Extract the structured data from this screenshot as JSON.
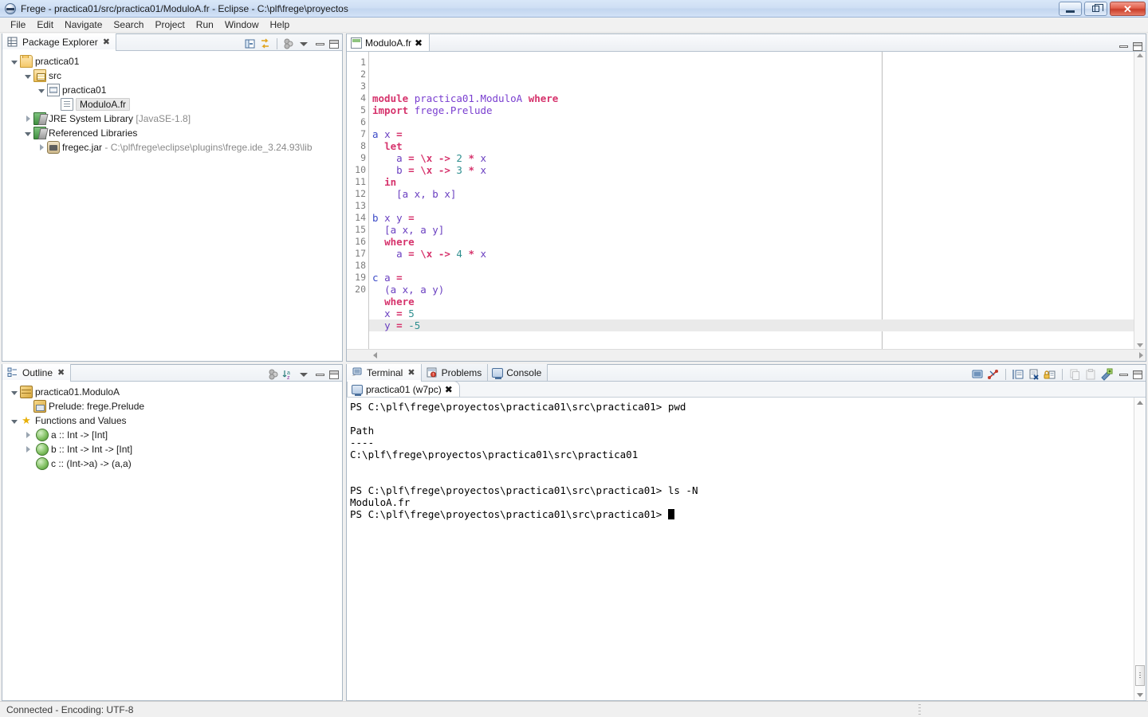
{
  "window": {
    "title": "Frege - practica01/src/practica01/ModuloA.fr - Eclipse - C:\\plf\\frege\\proyectos",
    "app_icon": "eclipse-icon",
    "controls": {
      "minimize": "minimize",
      "maximize": "restore",
      "close": "close"
    }
  },
  "menubar": {
    "items": [
      "File",
      "Edit",
      "Navigate",
      "Search",
      "Project",
      "Run",
      "Window",
      "Help"
    ]
  },
  "package_explorer": {
    "tab_label": "Package Explorer",
    "close_glyph": "✖",
    "toolbar": [
      "collapse-all-icon",
      "link-with-editor-icon",
      "view-menu-icon",
      "minimize-icon",
      "maximize-icon"
    ],
    "tree": [
      {
        "label": "practica01",
        "suffix": "",
        "icon": "project-folder-icon",
        "indent": 0,
        "twisty": "open",
        "selected": false
      },
      {
        "label": "src",
        "suffix": "",
        "icon": "source-folder-icon",
        "indent": 1,
        "twisty": "open",
        "selected": false
      },
      {
        "label": "practica01",
        "suffix": "",
        "icon": "package-icon",
        "indent": 2,
        "twisty": "open",
        "selected": false
      },
      {
        "label": "ModuloA.fr",
        "suffix": "",
        "icon": "frege-file-icon",
        "indent": 3,
        "twisty": "none",
        "selected": true
      },
      {
        "label": "JRE System Library",
        "suffix": " [JavaSE-1.8]",
        "icon": "jre-library-icon",
        "indent": 1,
        "twisty": "closed",
        "selected": false
      },
      {
        "label": "Referenced Libraries",
        "suffix": "",
        "icon": "library-icon",
        "indent": 1,
        "twisty": "open",
        "selected": false
      },
      {
        "label": "fregec.jar",
        "suffix": " - C:\\plf\\frege\\eclipse\\plugins\\frege.ide_3.24.93\\lib",
        "icon": "jar-icon",
        "indent": 2,
        "twisty": "closed",
        "selected": false
      }
    ]
  },
  "outline": {
    "tab_label": "Outline",
    "close_glyph": "✖",
    "toolbar": [
      "hide-fields-icon",
      "sort-icon",
      "view-menu-icon",
      "minimize-icon",
      "maximize-icon"
    ],
    "tree": [
      {
        "label": "practica01.ModuloA",
        "icon": "module-icon",
        "indent": 0,
        "twisty": "open"
      },
      {
        "label": "Prelude: frege.Prelude",
        "icon": "import-icon",
        "indent": 1,
        "twisty": "none"
      },
      {
        "label": "Functions and Values",
        "icon": "star-icon",
        "indent": 0,
        "twisty": "open"
      },
      {
        "label": "a :: Int -> [Int]",
        "icon": "function-icon",
        "indent": 1,
        "twisty": "closed"
      },
      {
        "label": "b :: Int -> Int -> [Int]",
        "icon": "function-icon",
        "indent": 1,
        "twisty": "closed"
      },
      {
        "label": "c :: (Int->a) -> (a,a)",
        "icon": "function-icon",
        "indent": 1,
        "twisty": "none"
      }
    ]
  },
  "editor": {
    "tab_label": "ModuloA.fr",
    "close_glyph": "✖",
    "file_icon": "frege-source-icon",
    "current_line": 20,
    "total_lines": 20,
    "toolbar": [
      "minimize-icon",
      "maximize-icon"
    ],
    "lines": [
      {
        "n": 1,
        "tokens": [
          {
            "t": "module",
            "c": "kw"
          },
          {
            "t": " ",
            "c": ""
          },
          {
            "t": "practica01.ModuloA",
            "c": "mod"
          },
          {
            "t": " ",
            "c": ""
          },
          {
            "t": "where",
            "c": "kw"
          }
        ]
      },
      {
        "n": 2,
        "tokens": [
          {
            "t": "import",
            "c": "kw"
          },
          {
            "t": " ",
            "c": ""
          },
          {
            "t": "frege.Prelude",
            "c": "mod"
          }
        ]
      },
      {
        "n": 3,
        "tokens": []
      },
      {
        "n": 4,
        "tokens": [
          {
            "t": "a",
            "c": "id"
          },
          {
            "t": " ",
            "c": ""
          },
          {
            "t": "x",
            "c": "pl"
          },
          {
            "t": " ",
            "c": ""
          },
          {
            "t": "=",
            "c": "op"
          }
        ]
      },
      {
        "n": 5,
        "tokens": [
          {
            "t": "  ",
            "c": ""
          },
          {
            "t": "let",
            "c": "kw"
          }
        ]
      },
      {
        "n": 6,
        "tokens": [
          {
            "t": "    ",
            "c": ""
          },
          {
            "t": "a",
            "c": "pl"
          },
          {
            "t": " ",
            "c": ""
          },
          {
            "t": "=",
            "c": "op"
          },
          {
            "t": " ",
            "c": ""
          },
          {
            "t": "\\x",
            "c": "op"
          },
          {
            "t": " ",
            "c": ""
          },
          {
            "t": "->",
            "c": "op"
          },
          {
            "t": " ",
            "c": ""
          },
          {
            "t": "2",
            "c": "num"
          },
          {
            "t": " ",
            "c": ""
          },
          {
            "t": "*",
            "c": "op"
          },
          {
            "t": " ",
            "c": ""
          },
          {
            "t": "x",
            "c": "pl"
          }
        ]
      },
      {
        "n": 7,
        "tokens": [
          {
            "t": "    ",
            "c": ""
          },
          {
            "t": "b",
            "c": "pl"
          },
          {
            "t": " ",
            "c": ""
          },
          {
            "t": "=",
            "c": "op"
          },
          {
            "t": " ",
            "c": ""
          },
          {
            "t": "\\x",
            "c": "op"
          },
          {
            "t": " ",
            "c": ""
          },
          {
            "t": "->",
            "c": "op"
          },
          {
            "t": " ",
            "c": ""
          },
          {
            "t": "3",
            "c": "num"
          },
          {
            "t": " ",
            "c": ""
          },
          {
            "t": "*",
            "c": "op"
          },
          {
            "t": " ",
            "c": ""
          },
          {
            "t": "x",
            "c": "pl"
          }
        ]
      },
      {
        "n": 8,
        "tokens": [
          {
            "t": "  ",
            "c": ""
          },
          {
            "t": "in",
            "c": "kw"
          }
        ]
      },
      {
        "n": 9,
        "tokens": [
          {
            "t": "    ",
            "c": ""
          },
          {
            "t": "[a x, b x]",
            "c": "pl"
          }
        ]
      },
      {
        "n": 10,
        "tokens": []
      },
      {
        "n": 11,
        "tokens": [
          {
            "t": "b",
            "c": "id"
          },
          {
            "t": " ",
            "c": ""
          },
          {
            "t": "x y",
            "c": "pl"
          },
          {
            "t": " ",
            "c": ""
          },
          {
            "t": "=",
            "c": "op"
          }
        ]
      },
      {
        "n": 12,
        "tokens": [
          {
            "t": "  ",
            "c": ""
          },
          {
            "t": "[a x, a y]",
            "c": "pl"
          }
        ]
      },
      {
        "n": 13,
        "tokens": [
          {
            "t": "  ",
            "c": ""
          },
          {
            "t": "where",
            "c": "kw"
          }
        ]
      },
      {
        "n": 14,
        "tokens": [
          {
            "t": "    ",
            "c": ""
          },
          {
            "t": "a",
            "c": "pl"
          },
          {
            "t": " ",
            "c": ""
          },
          {
            "t": "=",
            "c": "op"
          },
          {
            "t": " ",
            "c": ""
          },
          {
            "t": "\\x",
            "c": "op"
          },
          {
            "t": " ",
            "c": ""
          },
          {
            "t": "->",
            "c": "op"
          },
          {
            "t": " ",
            "c": ""
          },
          {
            "t": "4",
            "c": "num"
          },
          {
            "t": " ",
            "c": ""
          },
          {
            "t": "*",
            "c": "op"
          },
          {
            "t": " ",
            "c": ""
          },
          {
            "t": "x",
            "c": "pl"
          }
        ]
      },
      {
        "n": 15,
        "tokens": []
      },
      {
        "n": 16,
        "tokens": [
          {
            "t": "c",
            "c": "id"
          },
          {
            "t": " ",
            "c": ""
          },
          {
            "t": "a",
            "c": "pl"
          },
          {
            "t": " ",
            "c": ""
          },
          {
            "t": "=",
            "c": "op"
          }
        ]
      },
      {
        "n": 17,
        "tokens": [
          {
            "t": "  ",
            "c": ""
          },
          {
            "t": "(a x, a y)",
            "c": "pl"
          }
        ]
      },
      {
        "n": 18,
        "tokens": [
          {
            "t": "  ",
            "c": ""
          },
          {
            "t": "where",
            "c": "kw"
          }
        ]
      },
      {
        "n": 19,
        "tokens": [
          {
            "t": "  ",
            "c": ""
          },
          {
            "t": "x",
            "c": "pl"
          },
          {
            "t": " ",
            "c": ""
          },
          {
            "t": "=",
            "c": "op"
          },
          {
            "t": " ",
            "c": ""
          },
          {
            "t": "5",
            "c": "num"
          }
        ]
      },
      {
        "n": 20,
        "tokens": [
          {
            "t": "  ",
            "c": ""
          },
          {
            "t": "y",
            "c": "pl"
          },
          {
            "t": " ",
            "c": ""
          },
          {
            "t": "=",
            "c": "op"
          },
          {
            "t": " ",
            "c": ""
          },
          {
            "t": "-5",
            "c": "num"
          }
        ]
      }
    ]
  },
  "bottom_panel": {
    "tabs": [
      {
        "label": "Terminal",
        "icon": "terminal-icon",
        "active": true,
        "closeable": true
      },
      {
        "label": "Problems",
        "icon": "problems-icon",
        "active": false,
        "closeable": false
      },
      {
        "label": "Console",
        "icon": "console-icon",
        "active": false,
        "closeable": false
      }
    ],
    "subtab": {
      "label": "practica01 (w7pc)",
      "icon": "console-icon",
      "close_glyph": "✖"
    },
    "toolbar": [
      "new-terminal-icon",
      "disconnect-icon",
      "toggle-command-input-icon",
      "clear-terminal-icon",
      "scroll-lock-icon",
      "copy-icon",
      "paste-icon",
      "settings-icon",
      "minimize-icon",
      "maximize-icon"
    ],
    "terminal_lines": [
      "PS C:\\plf\\frege\\proyectos\\practica01\\src\\practica01> pwd",
      "",
      "Path",
      "----",
      "C:\\plf\\frege\\proyectos\\practica01\\src\\practica01",
      "",
      "",
      "PS C:\\plf\\frege\\proyectos\\practica01\\src\\practica01> ls -N",
      "ModuloA.fr"
    ],
    "prompt_last": "PS C:\\plf\\frege\\proyectos\\practica01\\src\\practica01> "
  },
  "statusbar": {
    "message": "Connected - Encoding: UTF-8"
  },
  "colors": {
    "keyword": "#d6336c",
    "module": "#7a3fd0",
    "number": "#2f8f8f",
    "identifier": "#3b4ac7",
    "titlebar_gradient_top": "#d9e7f8",
    "selection_gray": "#e8e8e8",
    "current_line": "#eaeaea"
  }
}
